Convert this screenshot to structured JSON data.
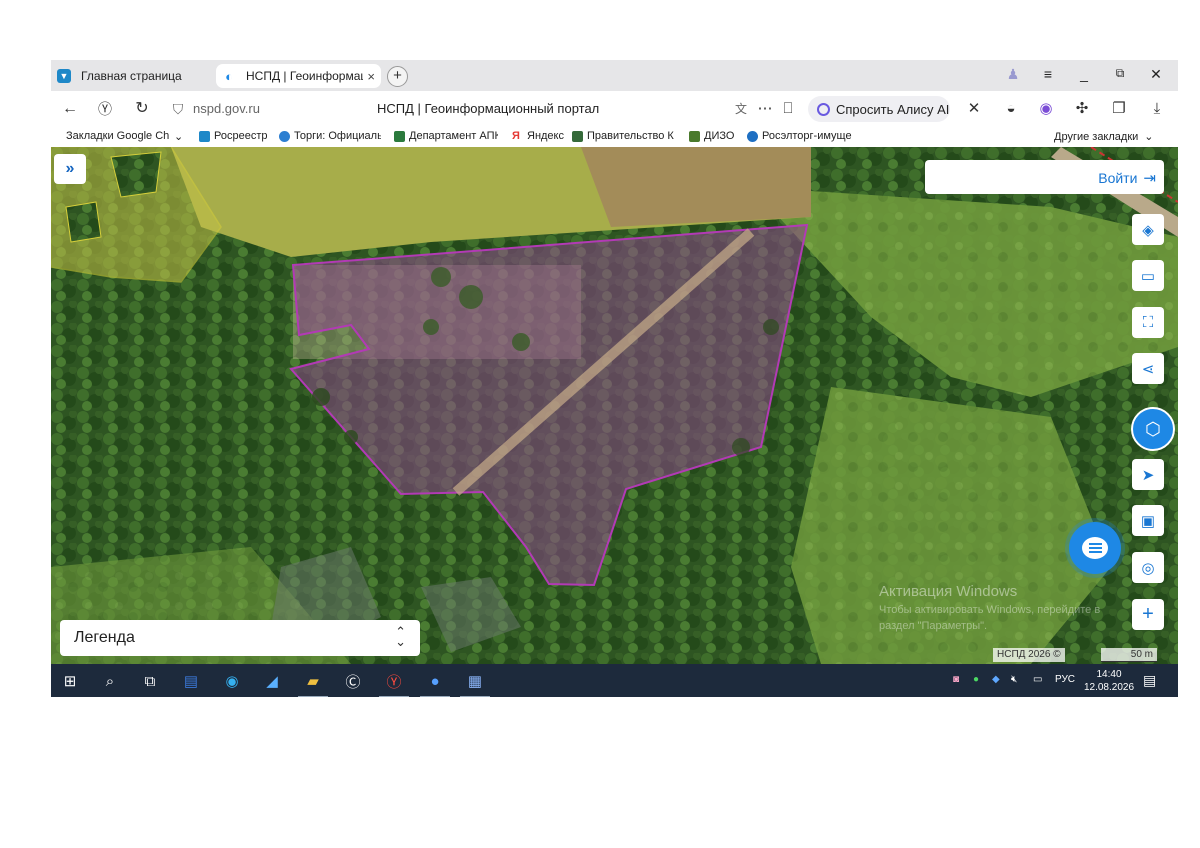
{
  "browser": {
    "tabs": [
      {
        "label": "Главная страница",
        "active": false
      },
      {
        "label": "НСПД | Геоинформационный портал",
        "active": true
      }
    ],
    "new_tab_label": "+",
    "close_tab_label": "×",
    "window_controls": {
      "minimize": "_",
      "restore": "⧉",
      "close": "✕",
      "menu": "≡"
    },
    "address": {
      "domain": "nspd.gov.ru",
      "page_title": "НСПД | Геоинформационный портал"
    },
    "alice_label": "Спросить Алису AI",
    "bookmarks": [
      "Закладки Google Ch",
      "Росреестр",
      "Торги: Официальн",
      "Департамент АПК",
      "Яндекс",
      "Правительство К",
      "ДИЗО",
      "Росэлторг-имуще"
    ],
    "other_bookmarks_label": "Другие закладки"
  },
  "map": {
    "login_label": "Войти",
    "legend_label": "Легенда",
    "expand_label": "»",
    "attribution": "НСПД 2026 ©",
    "scale_label": "50 m",
    "watermark": {
      "title": "Активация Windows",
      "line1": "Чтобы активировать Windows, перейдите в",
      "line2": "раздел \"Параметры\"."
    },
    "tools": [
      "layers-icon",
      "ruler-icon",
      "area-select-icon",
      "share-icon",
      "gosuslugi-icon",
      "navigate-icon",
      "window-icon",
      "location-pin-icon",
      "zoom-in-icon"
    ],
    "zoom_in_label": "+",
    "colors": {
      "parcel_border": "#b23ab5",
      "parcel_fill": "#8e4a8c",
      "zone_border": "#c9c332",
      "accent": "#1976d2"
    }
  },
  "taskbar": {
    "language": "РУС",
    "time": "14:40",
    "date": "12.08.2026"
  }
}
